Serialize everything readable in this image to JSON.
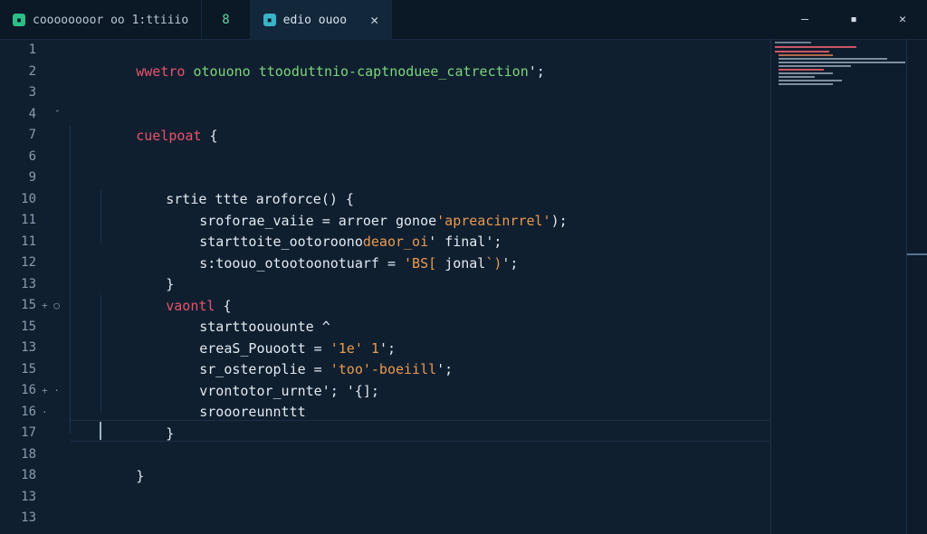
{
  "tabs": [
    {
      "label": "coooooooor oo 1:ttiiio",
      "icon": "file-icon",
      "close": "",
      "active": false
    },
    {
      "label": "8",
      "icon": "",
      "close": "",
      "active": false
    },
    {
      "label": "edio ouoo",
      "icon": "file-icon",
      "close": "✕",
      "active": true
    }
  ],
  "window_controls": {
    "minimize": "–",
    "maximize": "▪",
    "close": "✕"
  },
  "line_numbers": [
    "1",
    "2",
    "3",
    "4",
    "7",
    "6",
    "9",
    "10",
    "11",
    "11",
    "12",
    "13",
    "15",
    "15",
    "13",
    "15",
    "16",
    "16",
    "17",
    "18",
    "18",
    "13",
    "13"
  ],
  "fold_markers": {
    "4": "ˇ",
    "15a": "+ ○",
    "16b": "+ · ·"
  },
  "code": {
    "l1": {
      "kw": "wwetro",
      "a": " otouono ",
      "b": "ttooduttnio-captnoduee_catrection",
      "end": "';"
    },
    "l4": {
      "kw": "cuelpoat",
      "brace": " {"
    },
    "l9": {
      "a": "srtie ",
      "b": "ttte ",
      "c": "aroforce() {"
    },
    "l10": {
      "a": "sroforae_vaiie",
      "b": " = ",
      "c": "arroer ",
      "d": "gonoe",
      "e": "'apreacinrrel'",
      "end": ");"
    },
    "l11": {
      "a": "starttoite_ootoroono",
      "b": "deaor_oi",
      "c": "' ",
      "d": "final",
      "end": "';"
    },
    "l12": {
      "a": "s:toouo_otootoonotuarf",
      "b": " = ",
      "c": "'BS[ ",
      "d": "jonal",
      "e": "`)",
      "end": "';"
    },
    "l13": {
      "a": "}"
    },
    "l14": {
      "a": "vaontl ",
      "b": "{"
    },
    "l15": {
      "a": "starttoouounte",
      "b": " ^"
    },
    "l16": {
      "a": "ereaS_Pouoott",
      "b": " = ",
      "c": "'1e' ",
      "d": "1",
      "end": "';"
    },
    "l17": {
      "a": "sr_osteroplie",
      "b": " = ",
      "c": "'too'",
      "d": "-boeiill",
      "end": "';"
    },
    "l18": {
      "a": "vrontotor_urnte",
      "b": "'; ",
      "c": "'{]",
      "end": ";"
    },
    "l19": {
      "a": "sroooreunnttt"
    },
    "l20": {
      "a": "}"
    },
    "l22": {
      "a": "}"
    }
  },
  "colors": {
    "accent": "#e8536b",
    "string": "#e99a4e",
    "keyword_green": "#7cd67a",
    "bg": "#0f1f30"
  }
}
